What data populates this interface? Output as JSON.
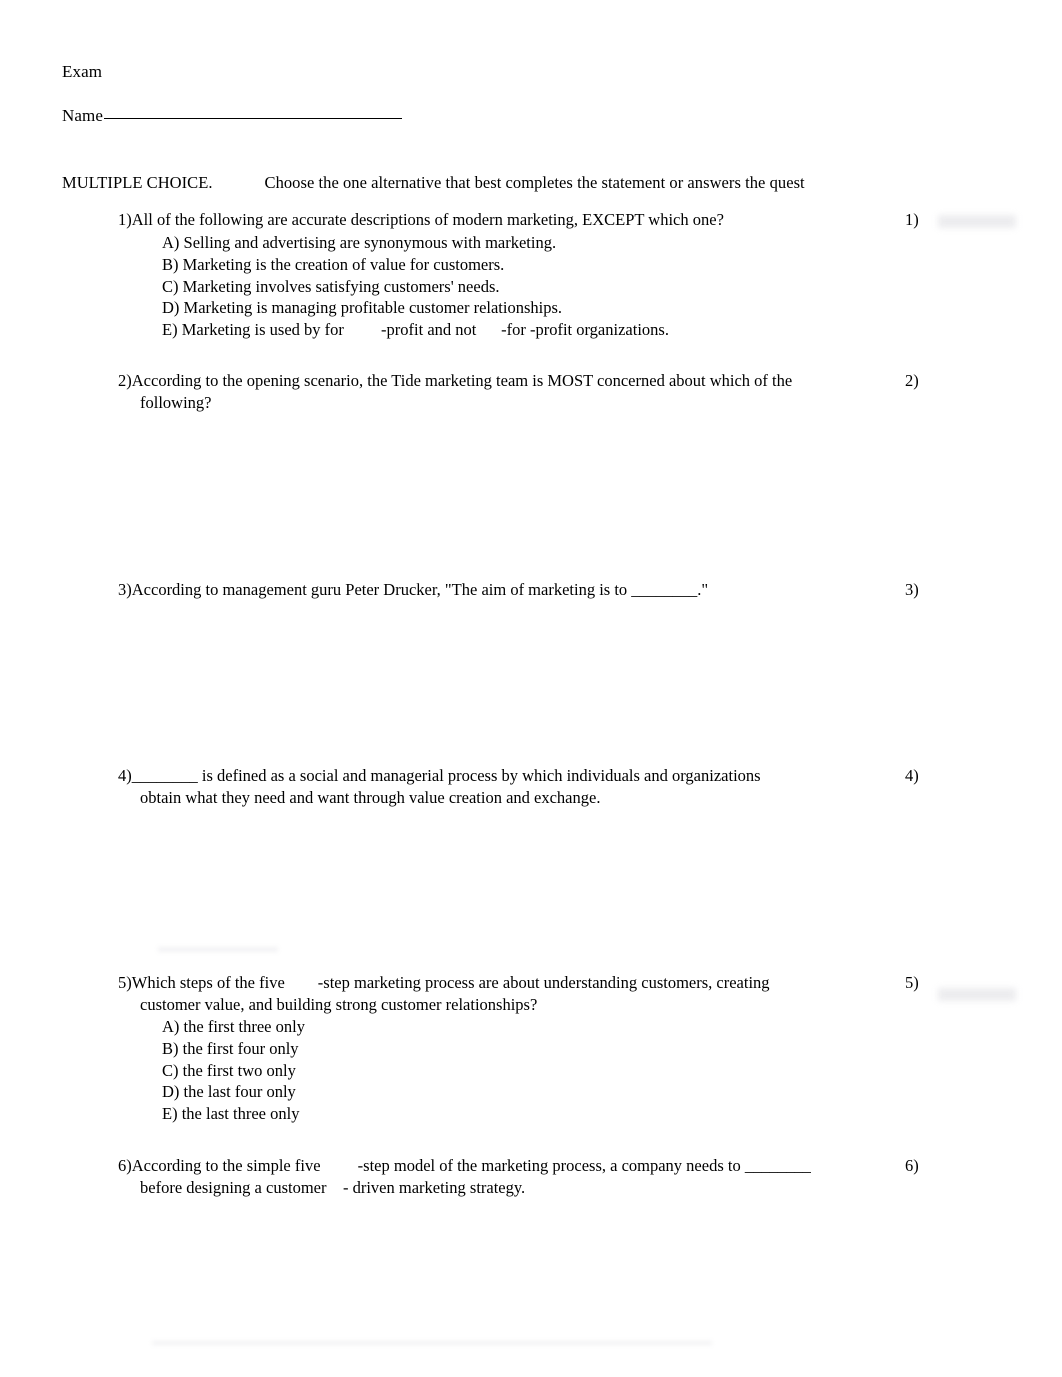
{
  "document": {
    "exam_title": "Exam",
    "name_label": "Name",
    "instructions": {
      "heading": "MULTIPLE CHOICE.",
      "text": "Choose the one alternative that best completes the statement or answers the quest"
    }
  },
  "questions": [
    {
      "number": "1)",
      "right_number": "1)",
      "lines": [
        "All of the following are accurate descriptions of modern marketing, EXCEPT which one?"
      ],
      "options": [
        "A) Selling and advertising are synonymous with marketing.",
        "B) Marketing is the creation of value for customers.",
        "C) Marketing involves satisfying customers' needs.",
        "D) Marketing is managing profitable customer relationships.",
        "E) Marketing is used by for         -profit and not      -for -profit organizations."
      ]
    },
    {
      "number": "2)",
      "right_number": "2)",
      "lines": [
        "According to the opening scenario, the Tide marketing team is MOST concerned about which of the",
        "following?"
      ],
      "options": []
    },
    {
      "number": "3)",
      "right_number": "3)",
      "lines": [
        "According to management guru Peter Drucker, \"The aim of marketing is to ________.\""
      ],
      "options": []
    },
    {
      "number": "4)",
      "right_number": "4)",
      "lines": [
        "________ is defined as a social and managerial process by which individuals and organizations",
        "obtain what they need and want through value creation and exchange."
      ],
      "options": []
    },
    {
      "number": "5)",
      "right_number": "5)",
      "lines": [
        "Which steps of the five        -step marketing process are about understanding customers, creating",
        "customer value, and building strong customer relationships?"
      ],
      "options": [
        "A) the first three only",
        "B) the first four only",
        "C) the first two only",
        "D) the last four only",
        "E) the last three only"
      ]
    },
    {
      "number": "6)",
      "right_number": "6)",
      "lines": [
        "According to the simple five         -step model of the marketing process, a company needs to ________",
        "before designing a customer    - driven marketing strategy."
      ],
      "options": []
    }
  ]
}
